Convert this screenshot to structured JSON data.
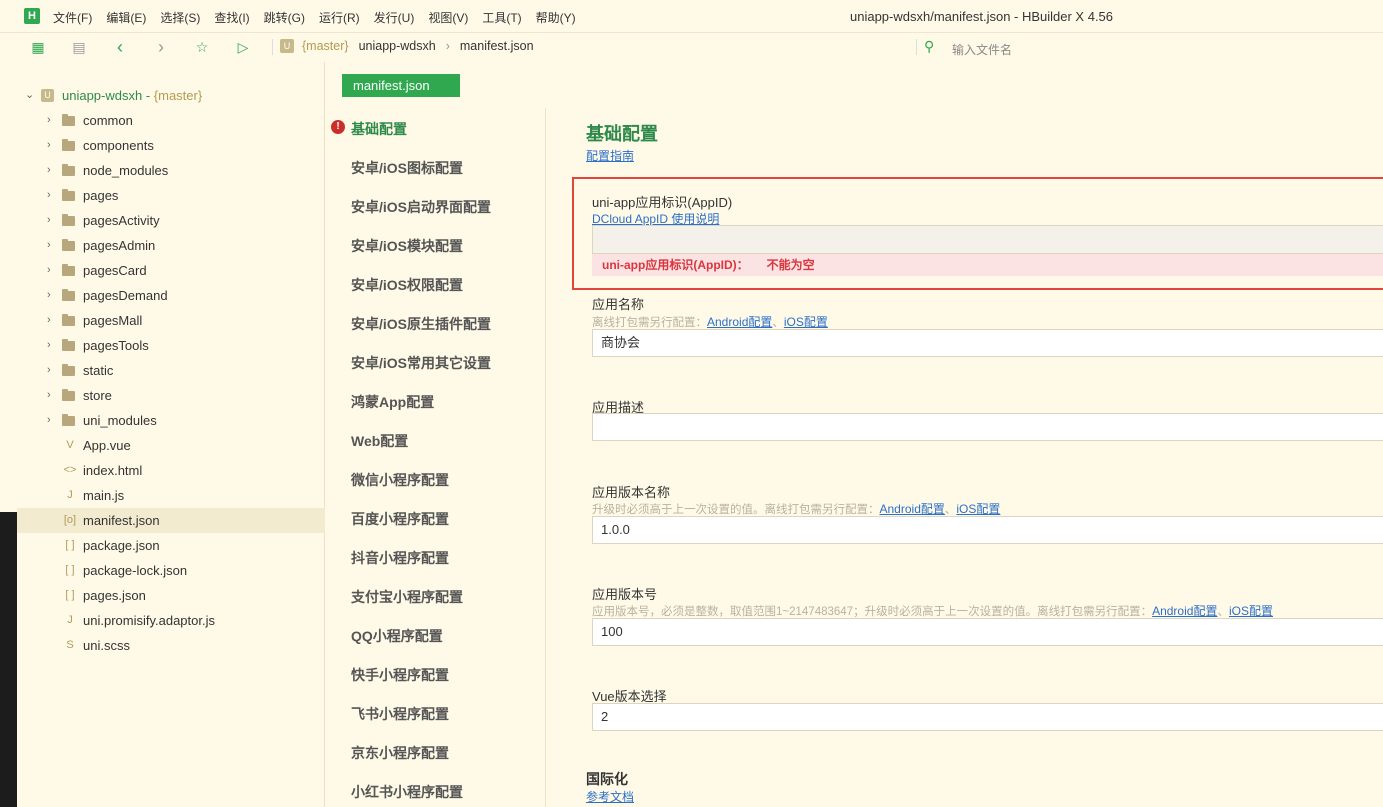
{
  "menubar": {
    "logo": "H",
    "menus": [
      "文件(F)",
      "编辑(E)",
      "选择(S)",
      "查找(I)",
      "跳转(G)",
      "运行(R)",
      "发行(U)",
      "视图(V)",
      "工具(T)",
      "帮助(Y)"
    ],
    "window_title": "uniapp-wdsxh/manifest.json - HBuilder X 4.56"
  },
  "toolbar": {
    "icons": [
      "new-file-icon",
      "save-icon",
      "back-icon",
      "forward-icon",
      "favorite-icon",
      "run-icon"
    ],
    "breadcrumb": {
      "branch": "{master}",
      "project": "uniapp-wdsxh",
      "file": "manifest.json"
    },
    "file_search_placeholder": "输入文件名"
  },
  "sidebar": {
    "root": {
      "name": "uniapp-wdsxh",
      "sep": " - ",
      "branch": "{master}"
    },
    "folders": [
      "common",
      "components",
      "node_modules",
      "pages",
      "pagesActivity",
      "pagesAdmin",
      "pagesCard",
      "pagesDemand",
      "pagesMall",
      "pagesTools",
      "static",
      "store",
      "uni_modules"
    ],
    "files": [
      {
        "name": "App.vue",
        "icon": "V"
      },
      {
        "name": "index.html",
        "icon": "<>"
      },
      {
        "name": "main.js",
        "icon": "J"
      },
      {
        "name": "manifest.json",
        "icon": "[o]",
        "active": true
      },
      {
        "name": "package.json",
        "icon": "[ ]"
      },
      {
        "name": "package-lock.json",
        "icon": "[ ]"
      },
      {
        "name": "pages.json",
        "icon": "[ ]"
      },
      {
        "name": "uni.promisify.adaptor.js",
        "icon": "J"
      },
      {
        "name": "uni.scss",
        "icon": "S"
      }
    ]
  },
  "editor": {
    "tab_label": "manifest.json",
    "nav_items": [
      "基础配置",
      "安卓/iOS图标配置",
      "安卓/iOS启动界面配置",
      "安卓/iOS模块配置",
      "安卓/iOS权限配置",
      "安卓/iOS原生插件配置",
      "安卓/iOS常用其它设置",
      "鸿蒙App配置",
      "Web配置",
      "微信小程序配置",
      "百度小程序配置",
      "抖音小程序配置",
      "支付宝小程序配置",
      "QQ小程序配置",
      "快手小程序配置",
      "飞书小程序配置",
      "京东小程序配置",
      "小红书小程序配置"
    ],
    "nav_warning_icon": "!",
    "section_title": "基础配置",
    "guide_link": "配置指南",
    "appid": {
      "label": "uni-app应用标识(AppID)",
      "link": "DCloud AppID 使用说明",
      "value": "",
      "error_label": "uni-app应用标识(AppID)：",
      "error_msg": "不能为空"
    },
    "app_name": {
      "label": "应用名称",
      "hint": "离线打包需另行配置：",
      "link_android": "Android配置",
      "link_ios": "iOS配置",
      "value": "商协会"
    },
    "app_desc": {
      "label": "应用描述",
      "value": ""
    },
    "version_name": {
      "label": "应用版本名称",
      "hint": "升级时必须高于上一次设置的值。离线打包需另行配置：",
      "link_android": "Android配置",
      "link_ios": "iOS配置",
      "value": "1.0.0"
    },
    "version_code": {
      "label": "应用版本号",
      "hint": "应用版本号，必须是整数，取值范围1~2147483647；升级时必须高于上一次设置的值。离线打包需另行配置：",
      "link_android": "Android配置",
      "link_ios": "iOS配置",
      "value": "100"
    },
    "vue_version": {
      "label": "Vue版本选择",
      "value": "2"
    },
    "i18n": {
      "title": "国际化",
      "link": "参考文档"
    },
    "link_sep": "、"
  },
  "colors": {
    "accent": "#2fa84f",
    "error": "#e0473b",
    "link": "#2b6fc9",
    "background": "#fffae8"
  }
}
